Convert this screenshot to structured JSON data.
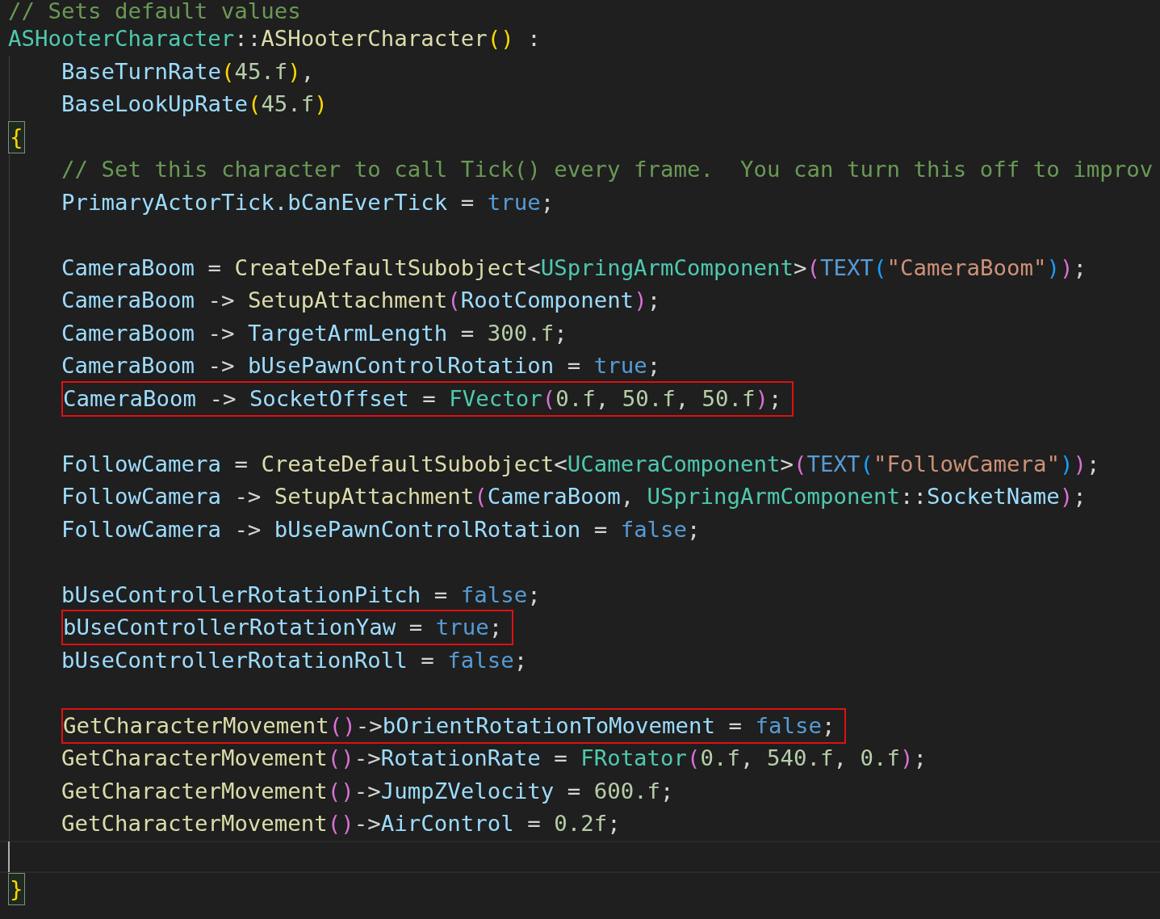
{
  "editor": {
    "lines": [
      {
        "kind": "code",
        "boxed": false,
        "current": false,
        "tokens": [
          {
            "kind": "comment",
            "text": "// Sets default values"
          }
        ]
      },
      {
        "kind": "code",
        "boxed": false,
        "current": false,
        "tokens": [
          {
            "kind": "type",
            "text": "ASHooterCharacter"
          },
          {
            "kind": "plain",
            "text": "::"
          },
          {
            "kind": "func",
            "text": "ASHooterCharacter"
          },
          {
            "kind": "p1",
            "text": "()"
          },
          {
            "kind": "plain",
            "text": " :"
          }
        ]
      },
      {
        "kind": "code",
        "boxed": false,
        "current": false,
        "indented": true,
        "tokens": [
          {
            "kind": "var",
            "text": "BaseTurnRate"
          },
          {
            "kind": "p1",
            "text": "("
          },
          {
            "kind": "num",
            "text": "45.f"
          },
          {
            "kind": "p1",
            "text": ")"
          },
          {
            "kind": "plain",
            "text": ","
          }
        ]
      },
      {
        "kind": "code",
        "boxed": false,
        "current": false,
        "indented": true,
        "tokens": [
          {
            "kind": "var",
            "text": "BaseLookUpRate"
          },
          {
            "kind": "p1",
            "text": "("
          },
          {
            "kind": "num",
            "text": "45.f"
          },
          {
            "kind": "p1",
            "text": ")"
          }
        ]
      },
      {
        "kind": "brace",
        "boxed": false,
        "current": false,
        "matched": true,
        "tokens": [
          {
            "kind": "p1",
            "text": "{"
          }
        ]
      },
      {
        "kind": "code",
        "boxed": false,
        "current": false,
        "indented": true,
        "tokens": [
          {
            "kind": "comment",
            "text": "// Set this character to call Tick() every frame.  You can turn this off to improv"
          }
        ]
      },
      {
        "kind": "code",
        "boxed": false,
        "current": false,
        "indented": true,
        "tokens": [
          {
            "kind": "var",
            "text": "PrimaryActorTick.bCanEverTick"
          },
          {
            "kind": "plain",
            "text": " = "
          },
          {
            "kind": "kw",
            "text": "true"
          },
          {
            "kind": "plain",
            "text": ";"
          }
        ]
      },
      {
        "kind": "blank",
        "boxed": false,
        "current": false
      },
      {
        "kind": "code",
        "boxed": false,
        "current": false,
        "indented": true,
        "tokens": [
          {
            "kind": "var",
            "text": "CameraBoom"
          },
          {
            "kind": "plain",
            "text": " = "
          },
          {
            "kind": "func",
            "text": "CreateDefaultSubobject"
          },
          {
            "kind": "plain",
            "text": "<"
          },
          {
            "kind": "type",
            "text": "USpringArmComponent"
          },
          {
            "kind": "plain",
            "text": ">"
          },
          {
            "kind": "p2",
            "text": "("
          },
          {
            "kind": "kw",
            "text": "TEXT"
          },
          {
            "kind": "p3",
            "text": "("
          },
          {
            "kind": "string",
            "text": "\"CameraBoom\""
          },
          {
            "kind": "p3",
            "text": ")"
          },
          {
            "kind": "p2",
            "text": ")"
          },
          {
            "kind": "plain",
            "text": ";"
          }
        ]
      },
      {
        "kind": "code",
        "boxed": false,
        "current": false,
        "indented": true,
        "tokens": [
          {
            "kind": "var",
            "text": "CameraBoom"
          },
          {
            "kind": "plain",
            "text": " -> "
          },
          {
            "kind": "func",
            "text": "SetupAttachment"
          },
          {
            "kind": "p2",
            "text": "("
          },
          {
            "kind": "var",
            "text": "RootComponent"
          },
          {
            "kind": "p2",
            "text": ")"
          },
          {
            "kind": "plain",
            "text": ";"
          }
        ]
      },
      {
        "kind": "code",
        "boxed": false,
        "current": false,
        "indented": true,
        "tokens": [
          {
            "kind": "var",
            "text": "CameraBoom"
          },
          {
            "kind": "plain",
            "text": " -> "
          },
          {
            "kind": "var",
            "text": "TargetArmLength"
          },
          {
            "kind": "plain",
            "text": " = "
          },
          {
            "kind": "num",
            "text": "300.f"
          },
          {
            "kind": "plain",
            "text": ";"
          }
        ]
      },
      {
        "kind": "code",
        "boxed": false,
        "current": false,
        "indented": true,
        "tokens": [
          {
            "kind": "var",
            "text": "CameraBoom"
          },
          {
            "kind": "plain",
            "text": " -> "
          },
          {
            "kind": "var",
            "text": "bUsePawnControlRotation"
          },
          {
            "kind": "plain",
            "text": " = "
          },
          {
            "kind": "kw",
            "text": "true"
          },
          {
            "kind": "plain",
            "text": ";"
          }
        ]
      },
      {
        "kind": "code",
        "boxed": true,
        "current": false,
        "indented": true,
        "tokens": [
          {
            "kind": "var",
            "text": "CameraBoom"
          },
          {
            "kind": "plain",
            "text": " -> "
          },
          {
            "kind": "var",
            "text": "SocketOffset"
          },
          {
            "kind": "plain",
            "text": " = "
          },
          {
            "kind": "type",
            "text": "FVector"
          },
          {
            "kind": "p2",
            "text": "("
          },
          {
            "kind": "num",
            "text": "0.f"
          },
          {
            "kind": "plain",
            "text": ", "
          },
          {
            "kind": "num",
            "text": "50.f"
          },
          {
            "kind": "plain",
            "text": ", "
          },
          {
            "kind": "num",
            "text": "50.f"
          },
          {
            "kind": "p2",
            "text": ")"
          },
          {
            "kind": "plain",
            "text": ";"
          }
        ]
      },
      {
        "kind": "blank",
        "boxed": false,
        "current": false
      },
      {
        "kind": "code",
        "boxed": false,
        "current": false,
        "indented": true,
        "tokens": [
          {
            "kind": "var",
            "text": "FollowCamera"
          },
          {
            "kind": "plain",
            "text": " = "
          },
          {
            "kind": "func",
            "text": "CreateDefaultSubobject"
          },
          {
            "kind": "plain",
            "text": "<"
          },
          {
            "kind": "type",
            "text": "UCameraComponent"
          },
          {
            "kind": "plain",
            "text": ">"
          },
          {
            "kind": "p2",
            "text": "("
          },
          {
            "kind": "kw",
            "text": "TEXT"
          },
          {
            "kind": "p3",
            "text": "("
          },
          {
            "kind": "string",
            "text": "\"FollowCamera\""
          },
          {
            "kind": "p3",
            "text": ")"
          },
          {
            "kind": "p2",
            "text": ")"
          },
          {
            "kind": "plain",
            "text": ";"
          }
        ]
      },
      {
        "kind": "code",
        "boxed": false,
        "current": false,
        "indented": true,
        "tokens": [
          {
            "kind": "var",
            "text": "FollowCamera"
          },
          {
            "kind": "plain",
            "text": " -> "
          },
          {
            "kind": "func",
            "text": "SetupAttachment"
          },
          {
            "kind": "p2",
            "text": "("
          },
          {
            "kind": "var",
            "text": "CameraBoom"
          },
          {
            "kind": "plain",
            "text": ", "
          },
          {
            "kind": "type",
            "text": "USpringArmComponent"
          },
          {
            "kind": "plain",
            "text": "::"
          },
          {
            "kind": "var",
            "text": "SocketName"
          },
          {
            "kind": "p2",
            "text": ")"
          },
          {
            "kind": "plain",
            "text": ";"
          }
        ]
      },
      {
        "kind": "code",
        "boxed": false,
        "current": false,
        "indented": true,
        "tokens": [
          {
            "kind": "var",
            "text": "FollowCamera"
          },
          {
            "kind": "plain",
            "text": " -> "
          },
          {
            "kind": "var",
            "text": "bUsePawnControlRotation"
          },
          {
            "kind": "plain",
            "text": " = "
          },
          {
            "kind": "kw",
            "text": "false"
          },
          {
            "kind": "plain",
            "text": ";"
          }
        ]
      },
      {
        "kind": "blank",
        "boxed": false,
        "current": false
      },
      {
        "kind": "code",
        "boxed": false,
        "current": false,
        "indented": true,
        "tokens": [
          {
            "kind": "var",
            "text": "bUseControllerRotationPitch"
          },
          {
            "kind": "plain",
            "text": " = "
          },
          {
            "kind": "kw",
            "text": "false"
          },
          {
            "kind": "plain",
            "text": ";"
          }
        ]
      },
      {
        "kind": "code",
        "boxed": true,
        "current": false,
        "indented": true,
        "tokens": [
          {
            "kind": "var",
            "text": "bUseControllerRotationYaw"
          },
          {
            "kind": "plain",
            "text": " = "
          },
          {
            "kind": "kw",
            "text": "true"
          },
          {
            "kind": "plain",
            "text": ";"
          }
        ]
      },
      {
        "kind": "code",
        "boxed": false,
        "current": false,
        "indented": true,
        "tokens": [
          {
            "kind": "var",
            "text": "bUseControllerRotationRoll"
          },
          {
            "kind": "plain",
            "text": " = "
          },
          {
            "kind": "kw",
            "text": "false"
          },
          {
            "kind": "plain",
            "text": ";"
          }
        ]
      },
      {
        "kind": "blank",
        "boxed": false,
        "current": false
      },
      {
        "kind": "code",
        "boxed": true,
        "current": false,
        "indented": true,
        "tokens": [
          {
            "kind": "func",
            "text": "GetCharacterMovement"
          },
          {
            "kind": "p2",
            "text": "()"
          },
          {
            "kind": "plain",
            "text": "->"
          },
          {
            "kind": "var",
            "text": "bOrientRotationToMovement"
          },
          {
            "kind": "plain",
            "text": " = "
          },
          {
            "kind": "kw",
            "text": "false"
          },
          {
            "kind": "plain",
            "text": ";"
          }
        ]
      },
      {
        "kind": "code",
        "boxed": false,
        "current": false,
        "indented": true,
        "tokens": [
          {
            "kind": "func",
            "text": "GetCharacterMovement"
          },
          {
            "kind": "p2",
            "text": "()"
          },
          {
            "kind": "plain",
            "text": "->"
          },
          {
            "kind": "var",
            "text": "RotationRate"
          },
          {
            "kind": "plain",
            "text": " = "
          },
          {
            "kind": "type",
            "text": "FRotator"
          },
          {
            "kind": "p2",
            "text": "("
          },
          {
            "kind": "num",
            "text": "0.f"
          },
          {
            "kind": "plain",
            "text": ", "
          },
          {
            "kind": "num",
            "text": "540.f"
          },
          {
            "kind": "plain",
            "text": ", "
          },
          {
            "kind": "num",
            "text": "0.f"
          },
          {
            "kind": "p2",
            "text": ")"
          },
          {
            "kind": "plain",
            "text": ";"
          }
        ]
      },
      {
        "kind": "code",
        "boxed": false,
        "current": false,
        "indented": true,
        "tokens": [
          {
            "kind": "func",
            "text": "GetCharacterMovement"
          },
          {
            "kind": "p2",
            "text": "()"
          },
          {
            "kind": "plain",
            "text": "->"
          },
          {
            "kind": "var",
            "text": "JumpZVelocity"
          },
          {
            "kind": "plain",
            "text": " = "
          },
          {
            "kind": "num",
            "text": "600.f"
          },
          {
            "kind": "plain",
            "text": ";"
          }
        ]
      },
      {
        "kind": "code",
        "boxed": false,
        "current": false,
        "indented": true,
        "tokens": [
          {
            "kind": "func",
            "text": "GetCharacterMovement"
          },
          {
            "kind": "p2",
            "text": "()"
          },
          {
            "kind": "plain",
            "text": "->"
          },
          {
            "kind": "var",
            "text": "AirControl"
          },
          {
            "kind": "plain",
            "text": " = "
          },
          {
            "kind": "num",
            "text": "0.2f"
          },
          {
            "kind": "plain",
            "text": ";"
          }
        ]
      },
      {
        "kind": "blank",
        "boxed": false,
        "current": true
      },
      {
        "kind": "brace",
        "boxed": false,
        "current": false,
        "matched": true,
        "tokens": [
          {
            "kind": "p1",
            "text": "}"
          }
        ]
      }
    ]
  }
}
